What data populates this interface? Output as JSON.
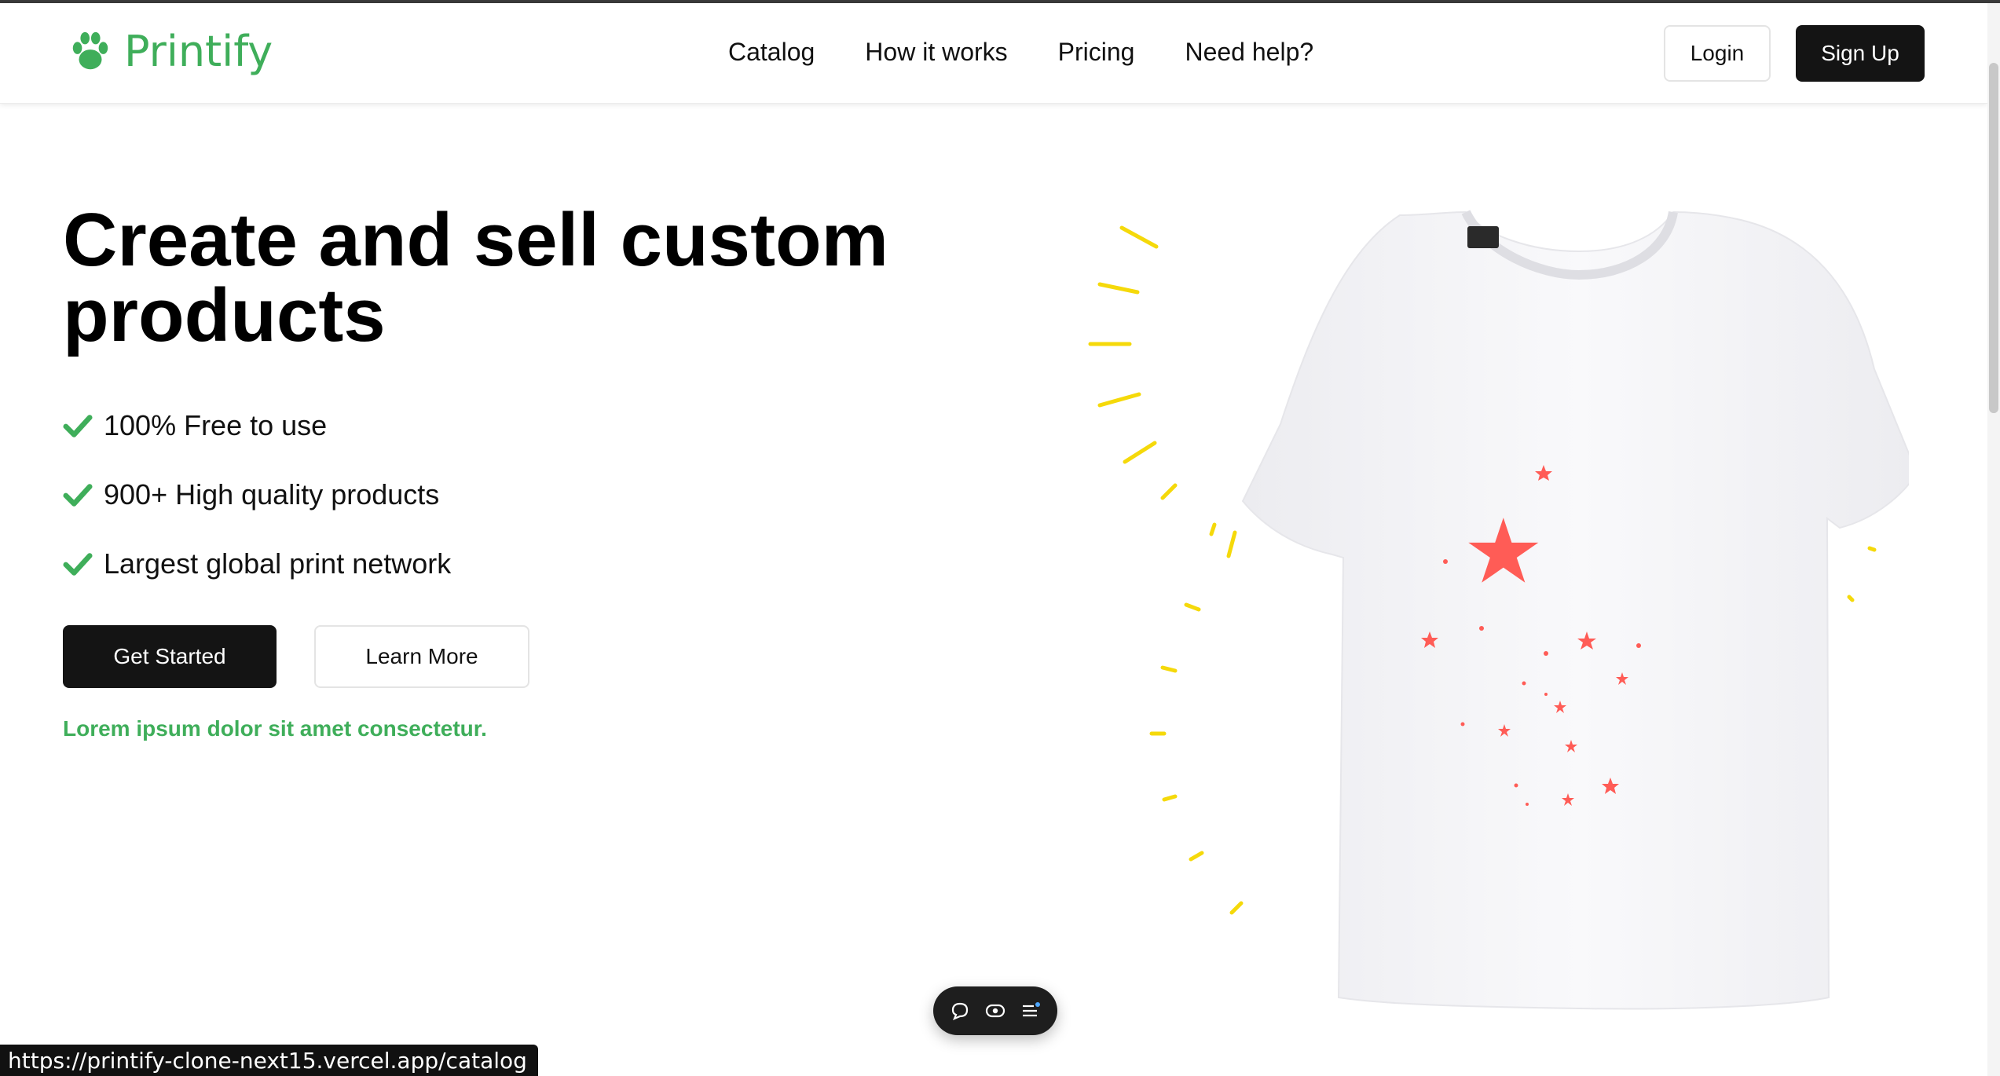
{
  "brand": {
    "name": "Printify",
    "logo_icon": "paw-icon",
    "accent_color": "#3fae5a"
  },
  "nav": {
    "items": [
      {
        "label": "Catalog"
      },
      {
        "label": "How it works"
      },
      {
        "label": "Pricing"
      },
      {
        "label": "Need help?"
      }
    ]
  },
  "auth": {
    "login_label": "Login",
    "signup_label": "Sign Up"
  },
  "hero": {
    "title": "Create and sell custom products",
    "features": [
      {
        "icon": "check-icon",
        "text": "100% Free to use"
      },
      {
        "icon": "check-icon",
        "text": "900+ High quality products"
      },
      {
        "icon": "check-icon",
        "text": "Largest global print network"
      }
    ],
    "primary_cta": "Get Started",
    "secondary_cta": "Learn More",
    "tagline": "Lorem ipsum dolor sit amet consectetur."
  },
  "illustration": {
    "subject": "white t-shirt with red stars",
    "ray_color": "#f5d90a",
    "star_color": "#ff5c56"
  },
  "floating_toolbar": {
    "icons": [
      "comment-icon",
      "eye-icon",
      "menu-icon"
    ]
  },
  "status_bar": {
    "url": "https://printify-clone-next15.vercel.app/catalog"
  }
}
